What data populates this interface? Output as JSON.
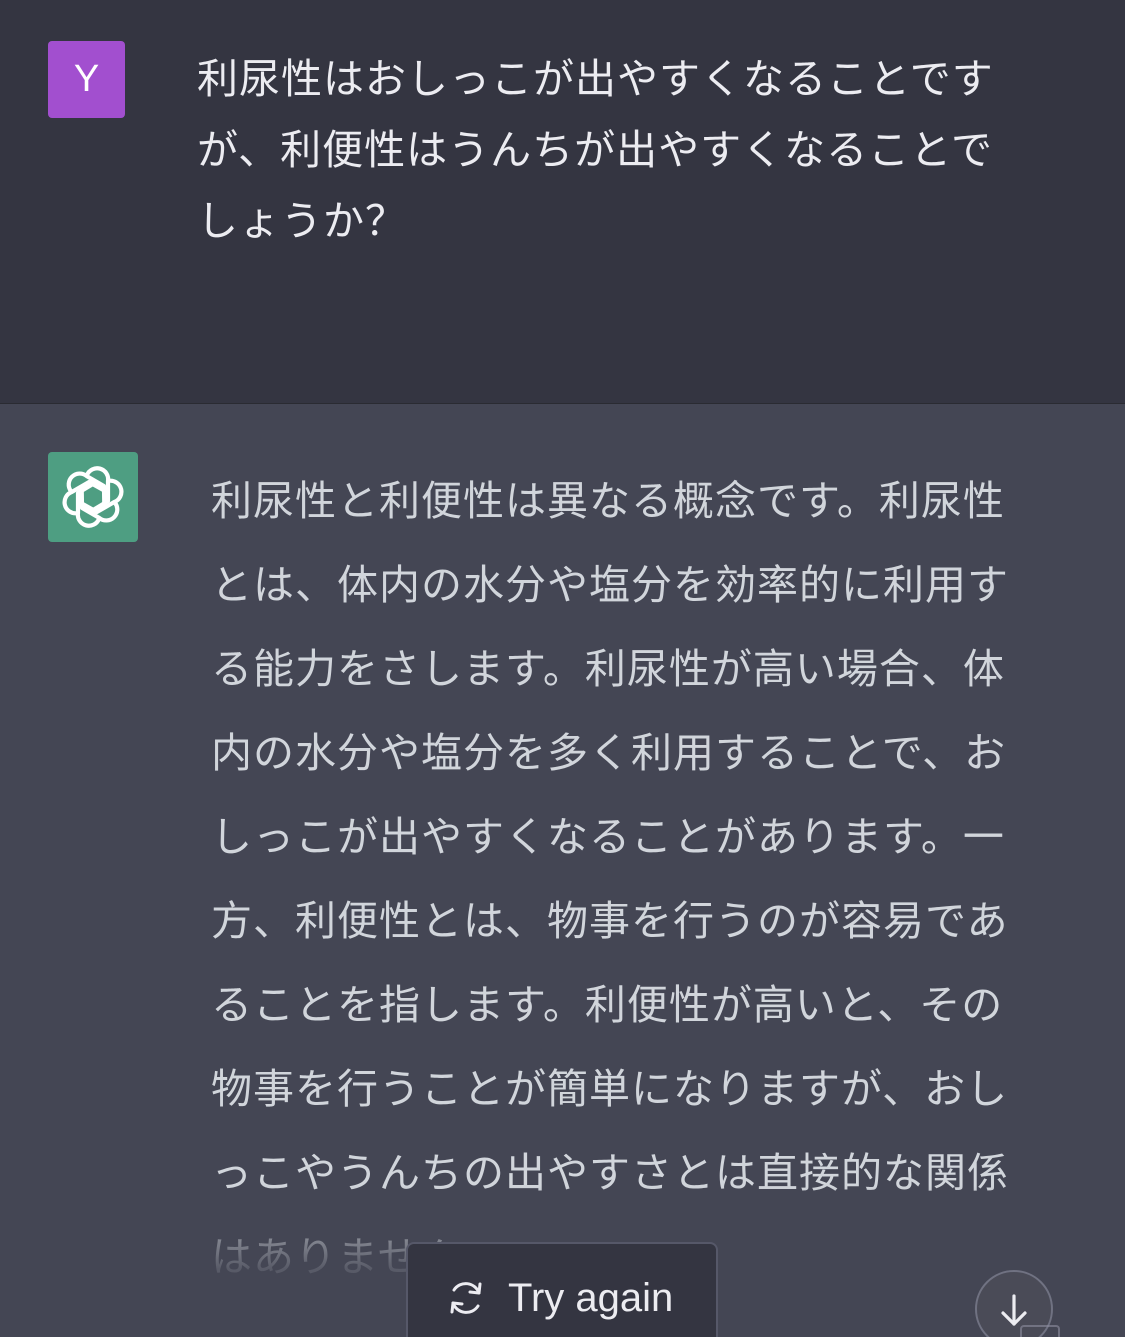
{
  "user_message": {
    "avatar_letter": "Y",
    "text": "利尿性はおしっこが出やすくなることです\nが、利便性はうんちが出やすくなることで\nしょうか？"
  },
  "assistant_message": {
    "avatar_icon": "openai-logo-icon",
    "text": "利尿性と利便性は異なる概念です。利尿性\nとは、体内の水分や塩分を効率的に利用す\nる能力をさします。利尿性が高い場合、体\n内の水分や塩分を多く利用することで、お\nしっこが出やすくなることがあります。一\n方、利便性とは、物事を行うのが容易であ\nることを指します。利便性が高いと、その\n物事を行うことが簡単になりますが、おし\nっこやうんちの出やすさとは直接的な関係\nはありません。"
  },
  "actions": {
    "try_again_label": "Try again",
    "try_again_icon": "refresh-icon",
    "scroll_icon": "arrow-down-icon"
  },
  "colors": {
    "user_bg": "#343541",
    "assistant_bg": "#444654",
    "user_avatar": "#a24fcf",
    "assistant_avatar": "#4e9e82"
  }
}
